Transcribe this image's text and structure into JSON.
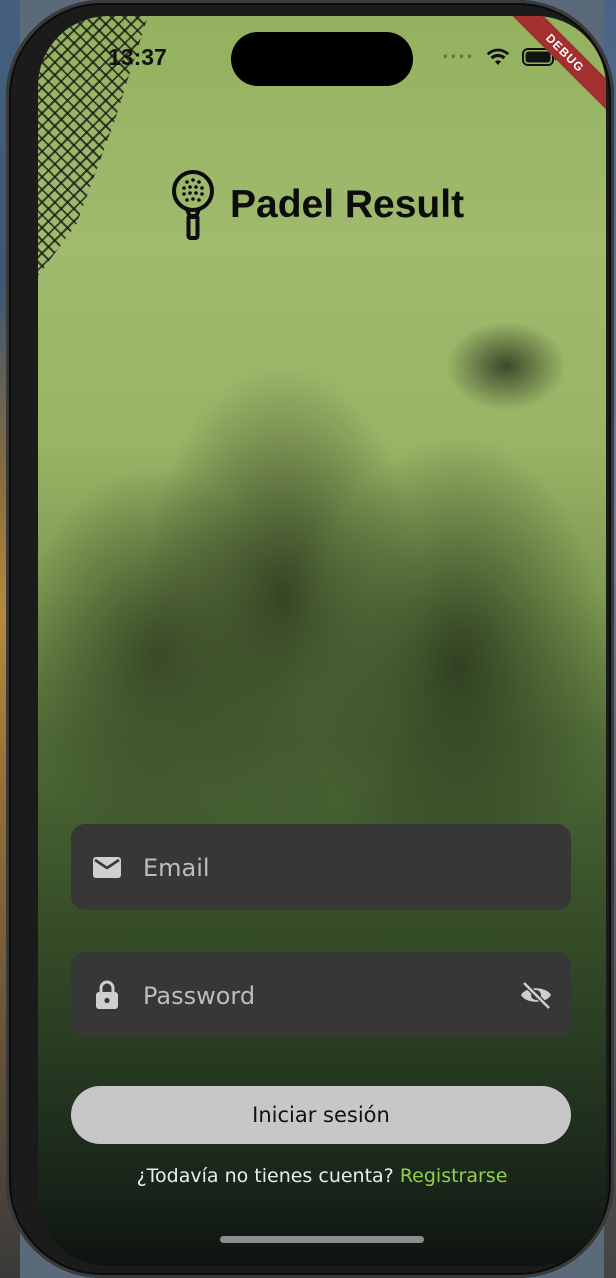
{
  "status_bar": {
    "time": "13:37",
    "signal_icon": "cellular-dots-icon",
    "wifi_icon": "wifi-icon",
    "battery_icon": "battery-icon"
  },
  "debug_banner": "DEBUG",
  "brand": {
    "title": "Padel Result",
    "logo_icon": "padel-racket-icon"
  },
  "login_form": {
    "email": {
      "placeholder": "Email",
      "value": "",
      "icon": "mail-icon"
    },
    "password": {
      "placeholder": "Password",
      "value": "",
      "icon": "lock-icon",
      "toggle_icon": "eye-off-icon"
    },
    "submit_label": "Iniciar sesión",
    "register_prompt": "¿Todavía no tienes cuenta?",
    "register_link": "Registrarse"
  },
  "colors": {
    "field_background": "#373737",
    "button_background": "#c7c7c7",
    "link_color": "#94cf4e",
    "debug_ribbon": "#a3302e"
  }
}
